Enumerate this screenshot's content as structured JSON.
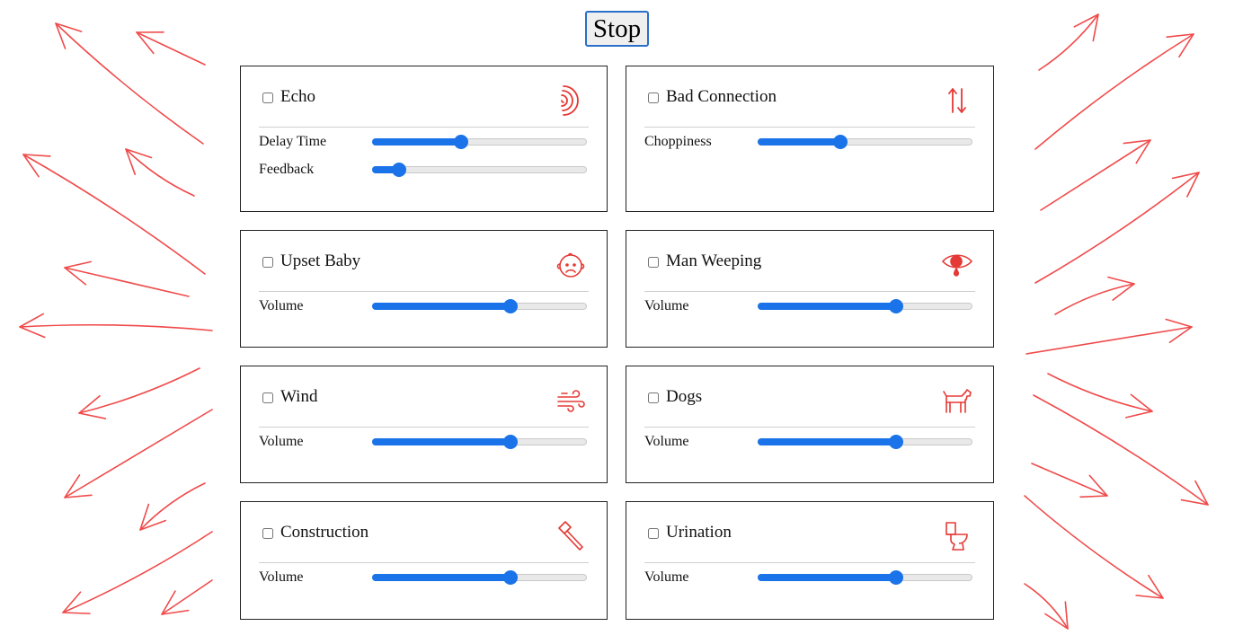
{
  "stop_button": {
    "label": "Stop"
  },
  "colors": {
    "accent": "#1a73e8",
    "decor_arrows": "#f04a4a",
    "icon_red": "#e53935"
  },
  "cards": [
    {
      "title": "Echo",
      "icon": "echo-waves-icon",
      "checked": false,
      "controls": [
        {
          "label": "Delay Time",
          "value": 0.41
        },
        {
          "label": "Feedback",
          "value": 0.12
        }
      ]
    },
    {
      "title": "Bad Connection",
      "icon": "up-down-arrows-icon",
      "checked": false,
      "controls": [
        {
          "label": "Choppiness",
          "value": 0.38
        }
      ]
    },
    {
      "title": "Upset Baby",
      "icon": "sad-baby-face-icon",
      "checked": false,
      "controls": [
        {
          "label": "Volume",
          "value": 0.64
        }
      ]
    },
    {
      "title": "Man Weeping",
      "icon": "weeping-eye-icon",
      "checked": false,
      "controls": [
        {
          "label": "Volume",
          "value": 0.64
        }
      ]
    },
    {
      "title": "Wind",
      "icon": "wind-icon",
      "checked": false,
      "controls": [
        {
          "label": "Volume",
          "value": 0.64
        }
      ]
    },
    {
      "title": "Dogs",
      "icon": "dog-icon",
      "checked": false,
      "controls": [
        {
          "label": "Volume",
          "value": 0.64
        }
      ]
    },
    {
      "title": "Construction",
      "icon": "hammer-icon",
      "checked": false,
      "controls": [
        {
          "label": "Volume",
          "value": 0.64
        }
      ]
    },
    {
      "title": "Urination",
      "icon": "toilet-icon",
      "checked": false,
      "controls": [
        {
          "label": "Volume",
          "value": 0.64
        }
      ]
    }
  ]
}
